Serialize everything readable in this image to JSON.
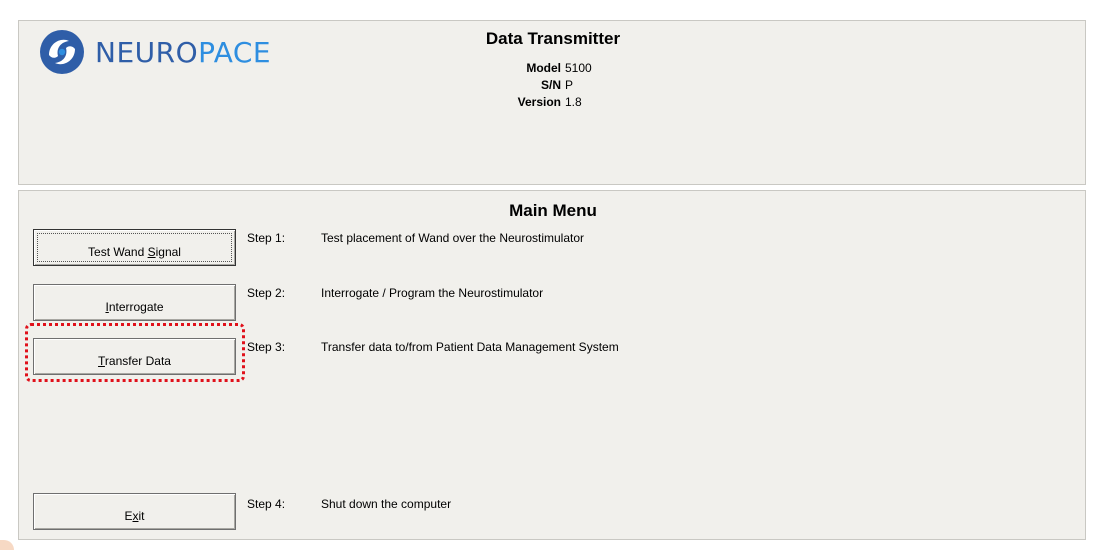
{
  "header": {
    "logo": {
      "icon": "neuropace-logo-icon",
      "text_part1": "NEURO",
      "text_part2": "PACE"
    },
    "title": "Data Transmitter",
    "specs": [
      {
        "key": "Model",
        "value": "5100"
      },
      {
        "key": "S/N",
        "value": "P"
      },
      {
        "key": "Version",
        "value": "1.8"
      }
    ]
  },
  "menu": {
    "title": "Main Menu",
    "buttons": {
      "test_wand": {
        "pre": "Test Wand ",
        "mnemonic": "S",
        "post": "ignal"
      },
      "interrogate": {
        "pre": "",
        "mnemonic": "I",
        "post": "nterrogate"
      },
      "transfer": {
        "pre": "",
        "mnemonic": "T",
        "post": "ransfer Data"
      },
      "exit": {
        "pre": "E",
        "mnemonic": "x",
        "post": "it"
      }
    },
    "steps": [
      {
        "label": "Step 1:",
        "desc": "Test placement of Wand over the Neurostimulator"
      },
      {
        "label": "Step 2:",
        "desc": "Interrogate / Program the Neurostimulator"
      },
      {
        "label": "Step 3:",
        "desc": "Transfer data to/from Patient Data Management System"
      },
      {
        "label": "Step 4:",
        "desc": "Shut down the computer"
      }
    ]
  },
  "colors": {
    "panel_bg": "#f1f0ec",
    "logo_blue": "#2f5ea8",
    "logo_light_blue": "#2e8ee0",
    "highlight_red": "#e0101a"
  }
}
